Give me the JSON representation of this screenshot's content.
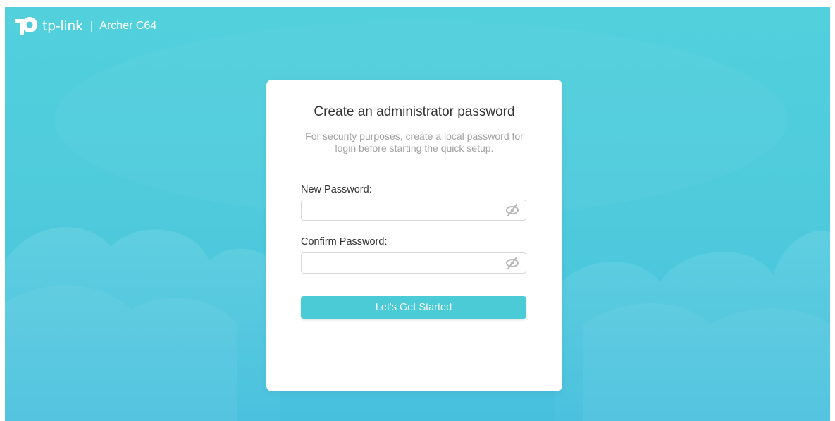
{
  "brand": {
    "logo_text": "tp-link",
    "separator": "|",
    "model": "Archer C64"
  },
  "dialog": {
    "title": "Create an administrator password",
    "description": "For security purposes, create a local password for login before starting the quick setup.",
    "new_password_label": "New Password:",
    "new_password_value": "",
    "confirm_password_label": "Confirm Password:",
    "confirm_password_value": "",
    "submit_label": "Let's Get Started"
  },
  "icons": {
    "logo": "tp-link-logo-icon",
    "password_visibility": "eye-slash-icon"
  },
  "colors": {
    "background": "#4fcbdc",
    "accent": "#4acbd6",
    "card": "#ffffff",
    "title_text": "#333333",
    "muted_text": "#a3a3a3"
  }
}
